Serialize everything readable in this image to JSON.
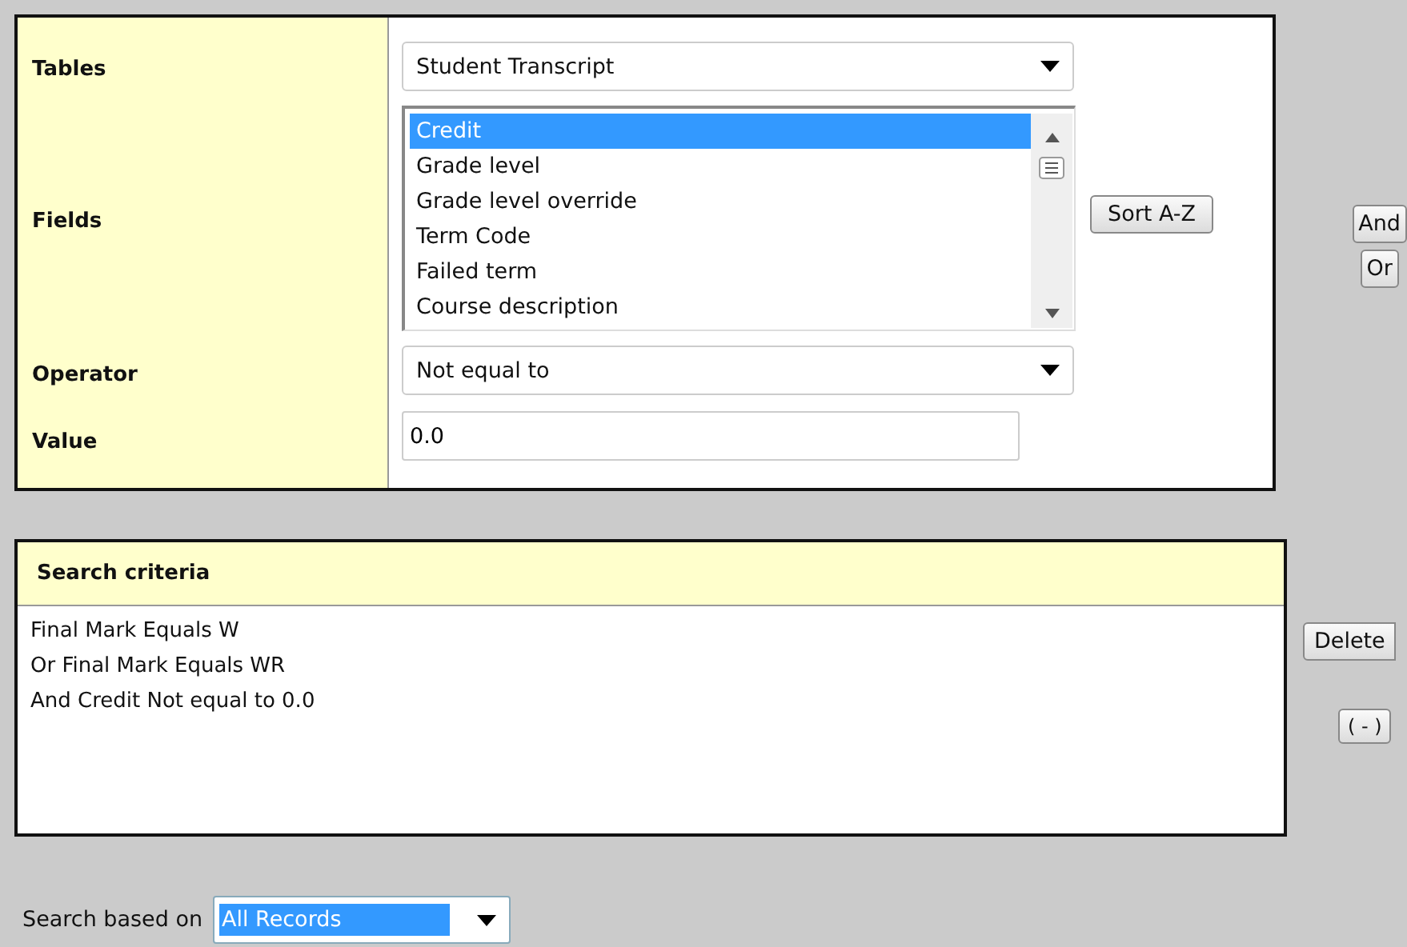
{
  "query_panel": {
    "tables": {
      "label": "Tables",
      "value": "Student Transcript"
    },
    "fields": {
      "label": "Fields",
      "items": [
        {
          "label": "Credit",
          "selected": true
        },
        {
          "label": "Grade level",
          "selected": false
        },
        {
          "label": "Grade level override",
          "selected": false
        },
        {
          "label": "Term Code",
          "selected": false
        },
        {
          "label": "Failed term",
          "selected": false
        },
        {
          "label": "Course description",
          "selected": false
        }
      ],
      "sort_button": "Sort A-Z"
    },
    "operator": {
      "label": "Operator",
      "value": "Not equal to"
    },
    "value": {
      "label": "Value",
      "value": "0.0"
    }
  },
  "logic_buttons": [
    "And",
    "Or"
  ],
  "criteria_panel": {
    "title": "Search criteria",
    "lines": [
      "Final Mark Equals W",
      "Or Final Mark Equals WR",
      "And Credit Not equal to 0.0"
    ]
  },
  "criteria_buttons": [
    "Delete",
    "( - )"
  ],
  "search_based_on": {
    "label": "Search based on",
    "value": "All Records",
    "highlighted": true
  }
}
